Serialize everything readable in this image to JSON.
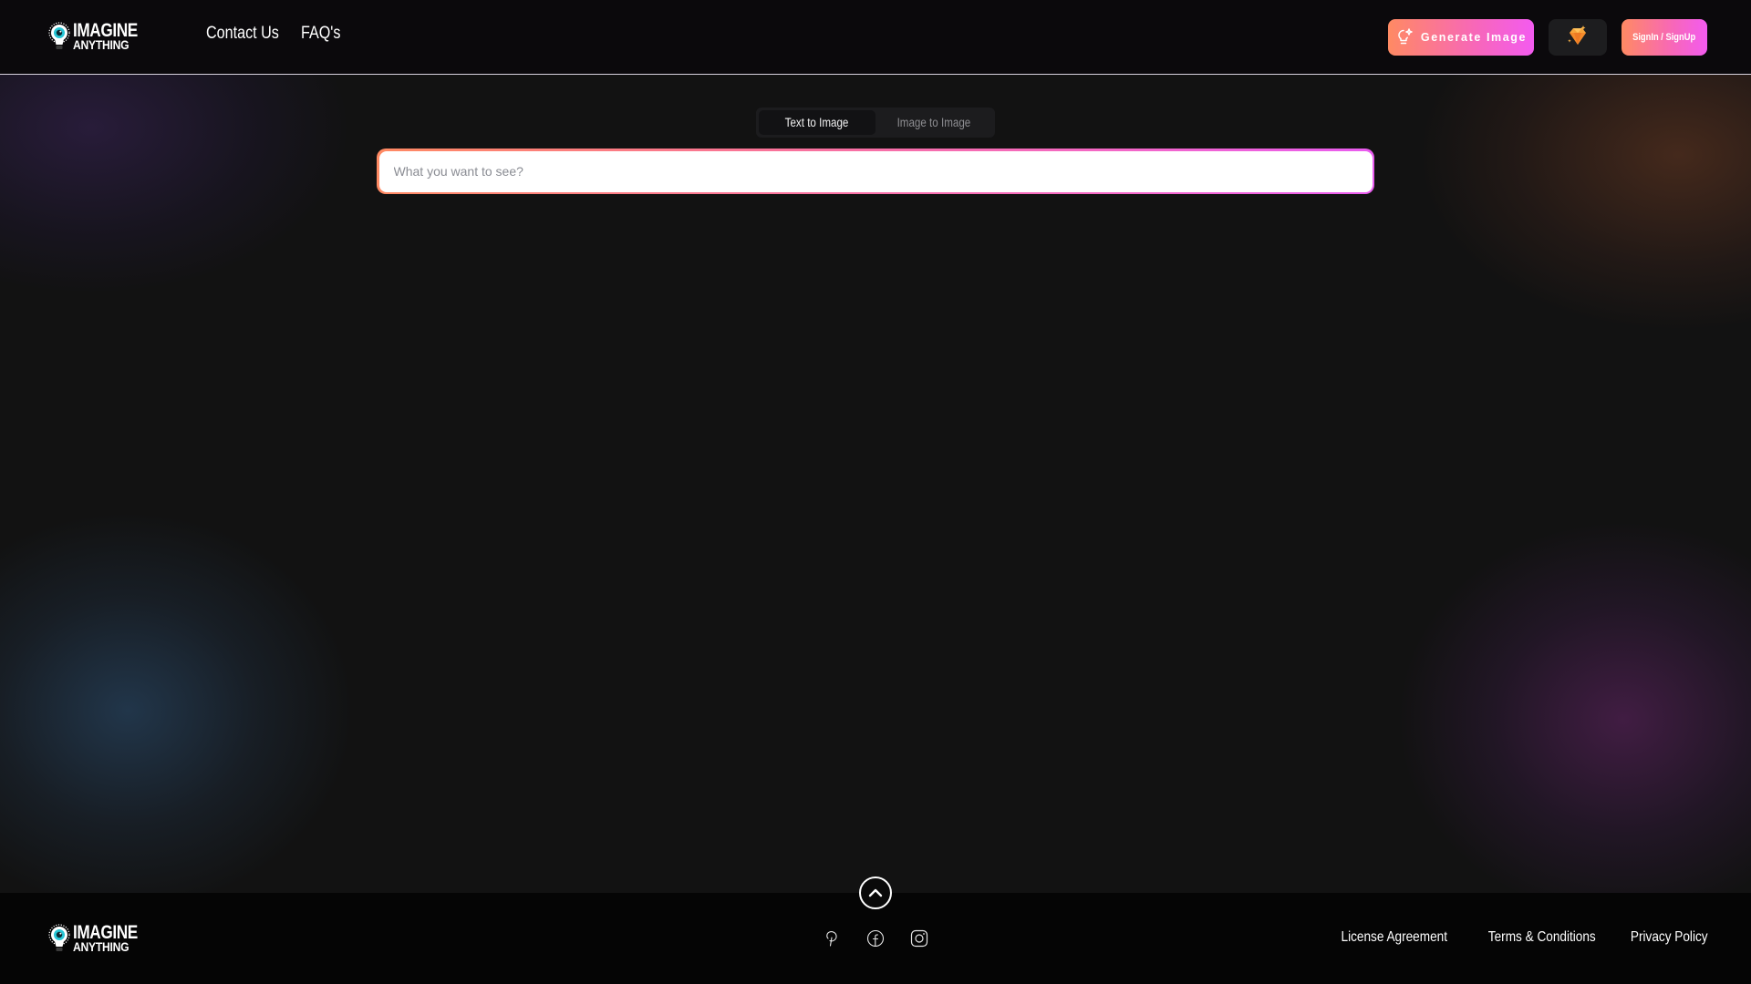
{
  "brand": {
    "line1": "IMAGINE",
    "line2": "ANYTHING",
    "colors": {
      "accent_gradient_start": "#ff8a63",
      "accent_gradient_end": "#f35bf0",
      "logo_eye": "#27c6d6"
    }
  },
  "header": {
    "nav": [
      {
        "label": "Contact Us"
      },
      {
        "label": "FAQ's"
      }
    ],
    "generate_button": {
      "label": "Generate Image",
      "icon": "lightbulb-sparkle-icon"
    },
    "gem_button": {
      "icon": "diamond-icon"
    },
    "signin_button": {
      "label": "SignIn / SignUp"
    }
  },
  "main": {
    "tabs": [
      {
        "label": "Text to Image",
        "active": true
      },
      {
        "label": "Image to Image",
        "active": false
      }
    ],
    "search": {
      "placeholder": "What you want to see?",
      "value": ""
    }
  },
  "footer": {
    "scroll_top_icon": "chevron-up-icon",
    "social": [
      {
        "name": "pinterest-icon"
      },
      {
        "name": "facebook-icon"
      },
      {
        "name": "instagram-icon"
      }
    ],
    "links": [
      {
        "label": "License Agreement"
      },
      {
        "label": "Terms & Conditions"
      },
      {
        "label": "Privacy Policy"
      }
    ]
  }
}
